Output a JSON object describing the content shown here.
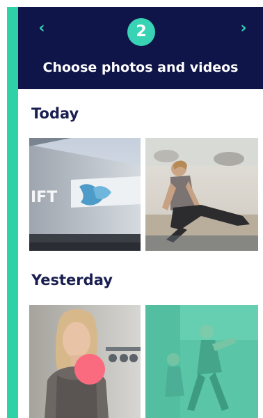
{
  "header": {
    "prev_icon": "chevron-left-icon",
    "next_icon": "chevron-right-icon",
    "step_number": "2",
    "title": "Choose photos and videos"
  },
  "sections": [
    {
      "title": "Today",
      "items": [
        {
          "kind": "photo",
          "description_icon": "building-photo"
        },
        {
          "kind": "photo",
          "description_icon": "yoga-photo"
        }
      ]
    },
    {
      "title": "Yesterday",
      "items": [
        {
          "kind": "photo",
          "description_icon": "portrait-photo",
          "selected": true
        },
        {
          "kind": "photo",
          "description_icon": "dance-photo",
          "selected": true
        }
      ]
    }
  ],
  "colors": {
    "header_bg": "#0f1548",
    "accent": "#2fd1a6",
    "badge": "#38d3b5",
    "section_text": "#1a1e50",
    "selection_dot": "#fb6b80",
    "selection_tint": "#2fd1a6"
  }
}
